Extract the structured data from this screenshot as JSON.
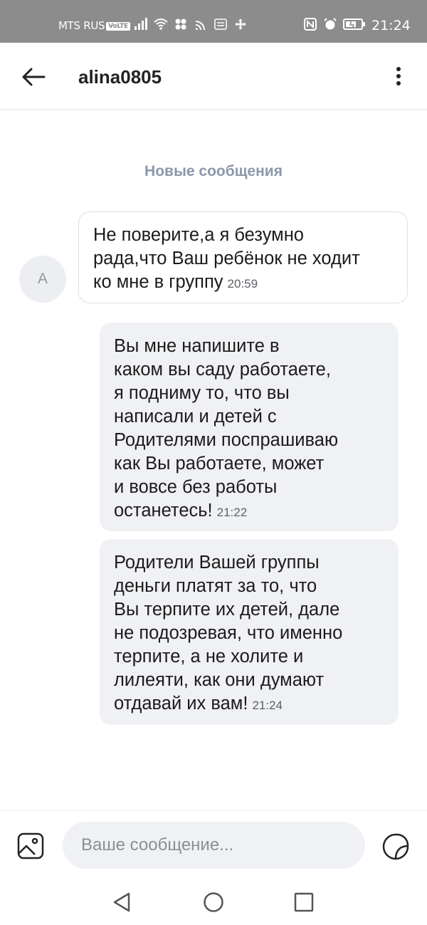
{
  "status_bar": {
    "carrier": "MTS RUS",
    "volte": "VoLTE",
    "time": "21:24"
  },
  "header": {
    "title": "alina0805",
    "back_icon": "arrow-left-icon",
    "more_icon": "more-vertical-icon"
  },
  "chat": {
    "divider_label": "Новые сообщения",
    "avatar_letter": "A",
    "messages": [
      {
        "direction": "incoming",
        "lines": [
          "Не поверите,а я безумно",
          "рада,что Ваш ребёнок не ходит",
          "ко мне в группу"
        ],
        "time": "20:59"
      },
      {
        "direction": "outgoing",
        "lines": [
          "Вы мне напишите в",
          "каком вы саду работаете,",
          "я подниму то, что вы",
          "написали и детей с",
          "Родителями поспрашиваю",
          "как Вы работаете, может",
          "и вовсе без работы",
          "останетесь!"
        ],
        "time": "21:22"
      },
      {
        "direction": "outgoing",
        "lines": [
          "Родители Вашей группы",
          "деньги платят за то, что",
          "Вы терпите их детей, дале",
          "не подозревая, что именно",
          "терпите, а не холите и",
          "лилеяти, как они думают",
          "отдавай их вам!"
        ],
        "time": "21:24"
      }
    ]
  },
  "composer": {
    "placeholder": "Ваше сообщение...",
    "attach_icon": "image-icon",
    "sticker_icon": "sticker-icon"
  },
  "colors": {
    "status_bar_bg": "#8c8c8c",
    "outgoing_bubble": "#f0f1f4",
    "divider_text": "#8a98a8"
  }
}
